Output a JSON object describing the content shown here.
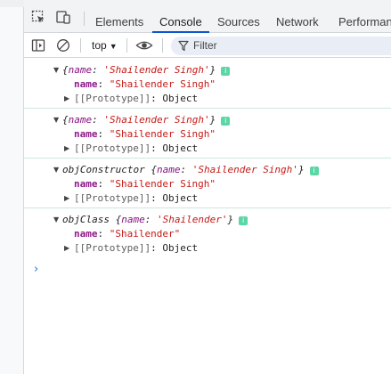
{
  "tabs": [
    {
      "label": "Elements"
    },
    {
      "label": "Console"
    },
    {
      "label": "Sources"
    },
    {
      "label": "Network"
    },
    {
      "label": "Performanc"
    }
  ],
  "toolbar": {
    "context": "top",
    "filter_placeholder": "Filter"
  },
  "logs": [
    {
      "prefix": "",
      "preview_key": "name",
      "preview_value": "'Shailender Singh'",
      "prop_key": "name",
      "prop_value": "\"Shailender Singh\"",
      "proto_label": "[[Prototype]]",
      "proto_value": "Object"
    },
    {
      "prefix": "",
      "preview_key": "name",
      "preview_value": "'Shailender Singh'",
      "prop_key": "name",
      "prop_value": "\"Shailender Singh\"",
      "proto_label": "[[Prototype]]",
      "proto_value": "Object"
    },
    {
      "prefix": "objConstructor",
      "preview_key": "name",
      "preview_value": "'Shailender Singh'",
      "prop_key": "name",
      "prop_value": "\"Shailender Singh\"",
      "proto_label": "[[Prototype]]",
      "proto_value": "Object"
    },
    {
      "prefix": "objClass",
      "preview_key": "name",
      "preview_value": "'Shailender'",
      "prop_key": "name",
      "prop_value": "\"Shailender\"",
      "proto_label": "[[Prototype]]",
      "proto_value": "Object"
    }
  ],
  "prompt_symbol": "›",
  "info_badge": "i",
  "colors": {
    "accent": "#0b57d0",
    "key": "#881280",
    "string": "#c41a16",
    "info_badge": "#5bd7a5",
    "entry_border": "#cfe7e0"
  }
}
